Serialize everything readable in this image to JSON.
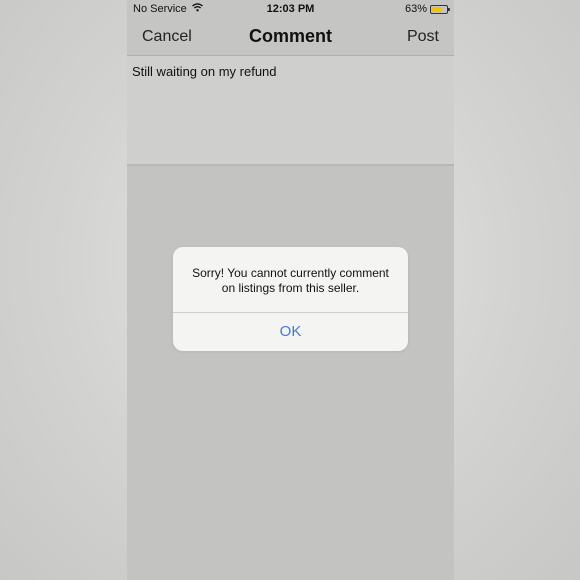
{
  "status_bar": {
    "carrier": "No Service",
    "wifi_icon": "wifi-icon",
    "time": "12:03 PM",
    "battery_percent": "63%",
    "battery_level": 0.63,
    "battery_color": "#f2c300"
  },
  "nav": {
    "cancel_label": "Cancel",
    "title": "Comment",
    "post_label": "Post"
  },
  "comment": {
    "text": "Still waiting on my refund"
  },
  "alert": {
    "message_line1": "Sorry! You cannot currently comment",
    "message_line2": "on listings from this seller.",
    "ok_label": "OK",
    "ok_color": "#3f7bd8"
  }
}
